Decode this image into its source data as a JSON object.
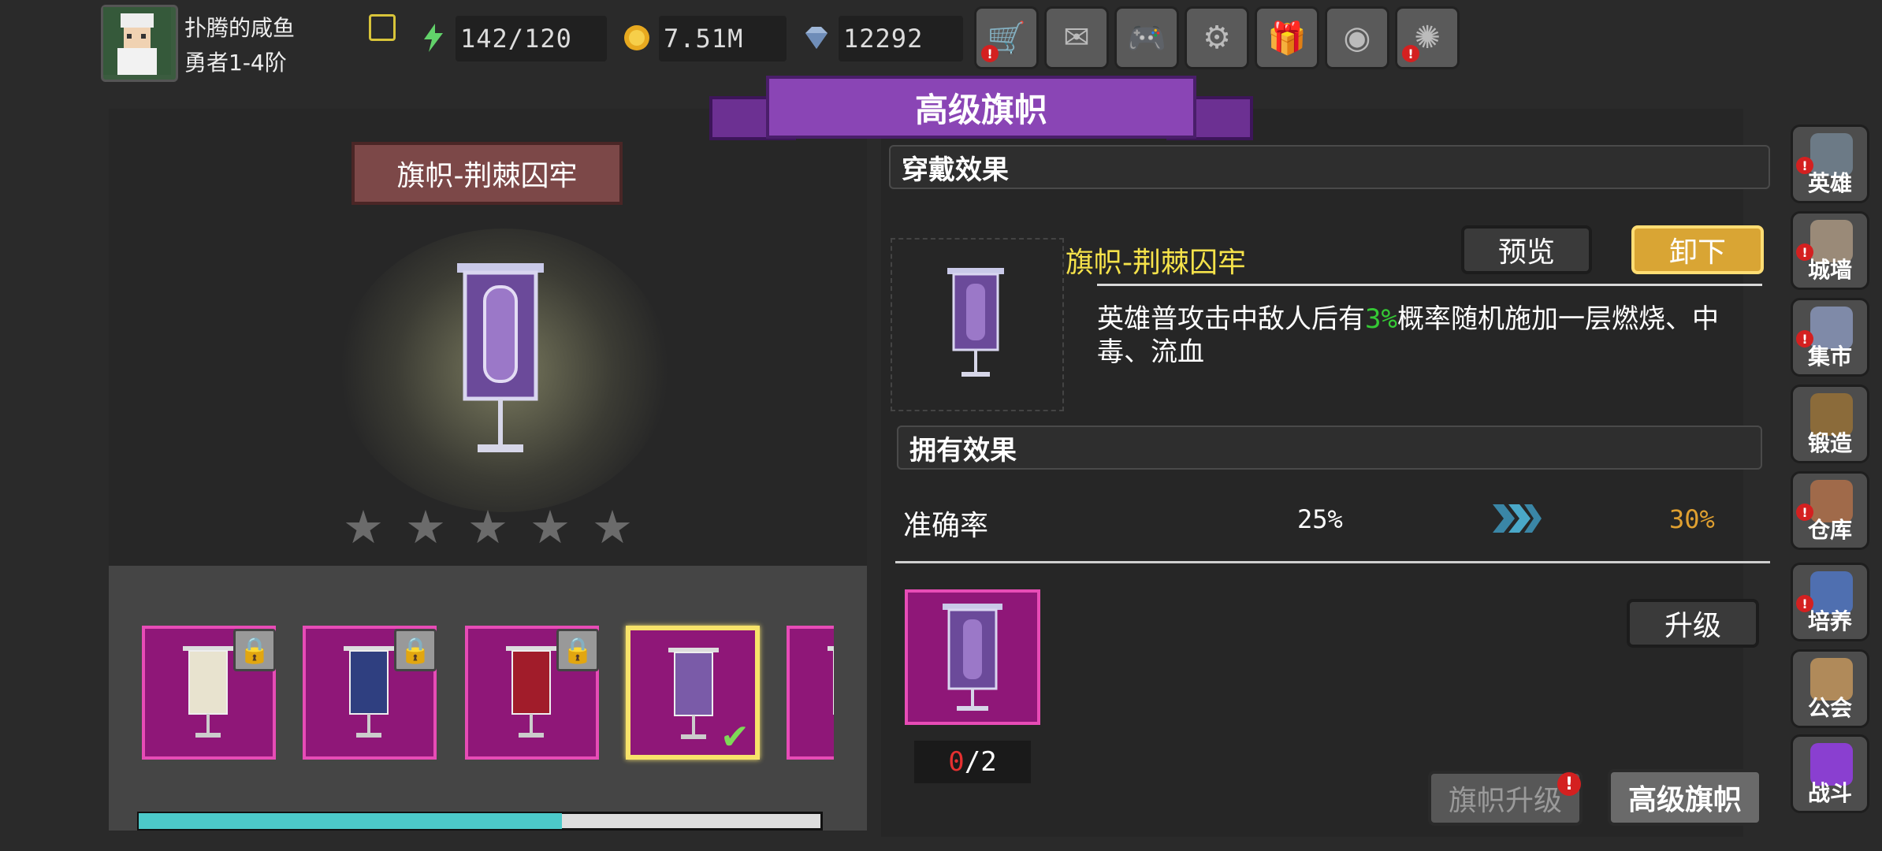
{
  "player": {
    "name": "扑腾的咸鱼",
    "rank": "勇者1-4阶"
  },
  "resources": {
    "energy": "142/120",
    "gold": "7.51M",
    "gems": "12292"
  },
  "top_buttons": [
    {
      "name": "shop",
      "icon": "shopping-cart-icon",
      "glyph": "🛒",
      "alert": true
    },
    {
      "name": "mail",
      "icon": "mail-icon",
      "glyph": "✉",
      "alert": false
    },
    {
      "name": "gamepad",
      "icon": "gamepad-icon",
      "glyph": "🎮",
      "alert": false
    },
    {
      "name": "settings",
      "icon": "gear-icon",
      "glyph": "⚙",
      "alert": false
    },
    {
      "name": "gift",
      "icon": "gift-icon",
      "glyph": "🎁",
      "alert": false
    },
    {
      "name": "color-wheel",
      "icon": "color-wheel-icon",
      "glyph": "◉",
      "alert": false
    },
    {
      "name": "fireworks",
      "icon": "fireworks-icon",
      "glyph": "✺",
      "alert": true
    }
  ],
  "header_title": "高级旗帜",
  "selected_banner_name": "旗帜-荆棘囚牢",
  "stars": {
    "filled": 0,
    "total": 5
  },
  "banner_slots": [
    {
      "color": "#e8e3cf",
      "locked": true,
      "selected": false
    },
    {
      "color": "#2f3f80",
      "locked": true,
      "selected": false
    },
    {
      "color": "#a11c2a",
      "locked": true,
      "selected": false
    },
    {
      "color": "#7a5ba8",
      "locked": false,
      "selected": true
    },
    {
      "color": "#7a5ba8",
      "locked": false,
      "selected": false
    }
  ],
  "scroll_progress": 0.62,
  "wear_effect": {
    "title": "穿戴效果",
    "item_name": "旗帜-荆棘囚牢",
    "desc_pre": "英雄普攻击中敌人后有",
    "desc_pct": "3%",
    "desc_post": "概率随机施加一层燃烧、中毒、流血",
    "preview_label": "预览",
    "unequip_label": "卸下"
  },
  "own_effect": {
    "title": "拥有效果",
    "stat_name": "准确率",
    "current": "25%",
    "next": "30%"
  },
  "upgrade": {
    "have": "0",
    "need": "/2",
    "button_label": "升级"
  },
  "bottom_tabs": {
    "banner_upgrade": "旗帜升级",
    "advanced_banner": "高级旗帜"
  },
  "side_menu": [
    {
      "label": "英雄",
      "icon": "helmet-icon",
      "color": "#6c7a86",
      "alert": true
    },
    {
      "label": "城墙",
      "icon": "wall-icon",
      "color": "#9a8a78",
      "alert": true
    },
    {
      "label": "集市",
      "icon": "market-icon",
      "color": "#7f8aa8",
      "alert": true
    },
    {
      "label": "锻造",
      "icon": "anvil-icon",
      "color": "#8b6b3a",
      "alert": false
    },
    {
      "label": "仓库",
      "icon": "warehouse-icon",
      "color": "#a06a4a",
      "alert": true
    },
    {
      "label": "培养",
      "icon": "trophy-icon",
      "color": "#4f6fb0",
      "alert": true
    },
    {
      "label": "公会",
      "icon": "guild-icon",
      "color": "#b08a5a",
      "alert": false
    },
    {
      "label": "战斗",
      "icon": "portal-icon",
      "color": "#8a3fd0",
      "alert": false
    }
  ],
  "colors": {
    "accent_purple": "#8a45b5",
    "gold": "#d9a534",
    "highlight_text": "#f5e24a",
    "pct_green": "#35c935",
    "next_orange": "#e0a030"
  }
}
